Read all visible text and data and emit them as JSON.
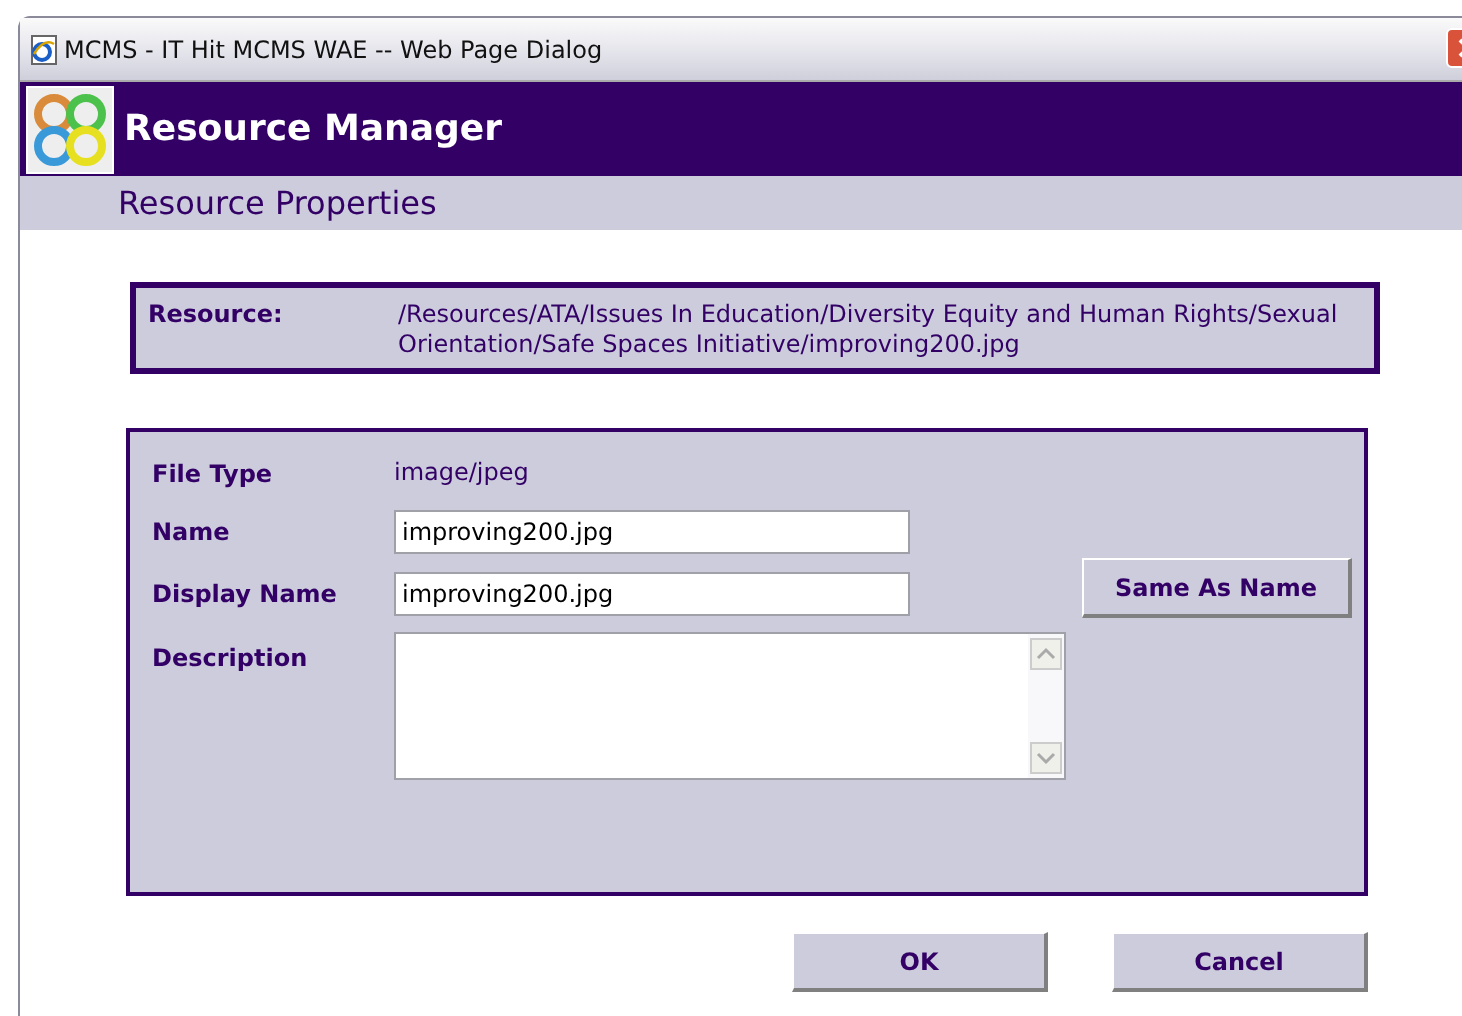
{
  "window": {
    "title": "MCMS - IT Hit MCMS WAE -- Web Page Dialog"
  },
  "header": {
    "title": "Resource Manager",
    "subtitle": "Resource Properties"
  },
  "resource": {
    "label": "Resource:",
    "path": "/Resources/ATA/Issues In Education/Diversity Equity and Human Rights/Sexual Orientation/Safe Spaces Initiative/improving200.jpg"
  },
  "form": {
    "file_type": {
      "label": "File Type",
      "value": "image/jpeg"
    },
    "name": {
      "label": "Name",
      "value": "improving200.jpg"
    },
    "display_name": {
      "label": "Display Name",
      "value": "improving200.jpg"
    },
    "same_as_name_button": "Same As Name",
    "description": {
      "label": "Description"
    }
  },
  "buttons": [
    "OK",
    "Cancel"
  ]
}
